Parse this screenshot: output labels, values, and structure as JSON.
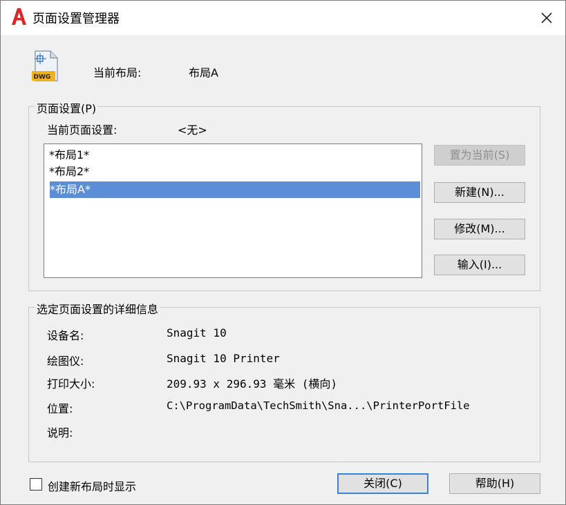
{
  "window": {
    "title": "页面设置管理器"
  },
  "header": {
    "current_layout_label": "当前布局:",
    "current_layout_value": "布局A",
    "file_icon_text": "DWG"
  },
  "page_setup_group": {
    "legend": "页面设置(P)",
    "current_setup_label": "当前页面设置:",
    "current_setup_value": "<无>",
    "items": [
      "*布局1*",
      "*布局2*",
      "*布局A*"
    ],
    "selected_index": 2,
    "buttons": {
      "set_current": "置为当前(S)",
      "new": "新建(N)...",
      "modify": "修改(M)...",
      "import": "输入(I)..."
    }
  },
  "details_group": {
    "legend": "选定页面设置的详细信息",
    "rows": [
      {
        "label": "设备名:",
        "value": "Snagit 10"
      },
      {
        "label": "绘图仪:",
        "value": "Snagit 10 Printer"
      },
      {
        "label": "打印大小:",
        "value": "209.93 x 296.93 毫米 (横向)"
      },
      {
        "label": "位置:",
        "value": "C:\\ProgramData\\TechSmith\\Sna...\\PrinterPortFile"
      },
      {
        "label": "说明:",
        "value": ""
      }
    ]
  },
  "footer": {
    "checkbox_label": "创建新布局时显示",
    "checkbox_checked": false,
    "close_button": "关闭(C)",
    "help_button": "帮助(H)"
  },
  "colors": {
    "selection": "#5b8ed6",
    "app_icon_red": "#d42a2a",
    "dialog_bg": "#f0f0f0"
  }
}
